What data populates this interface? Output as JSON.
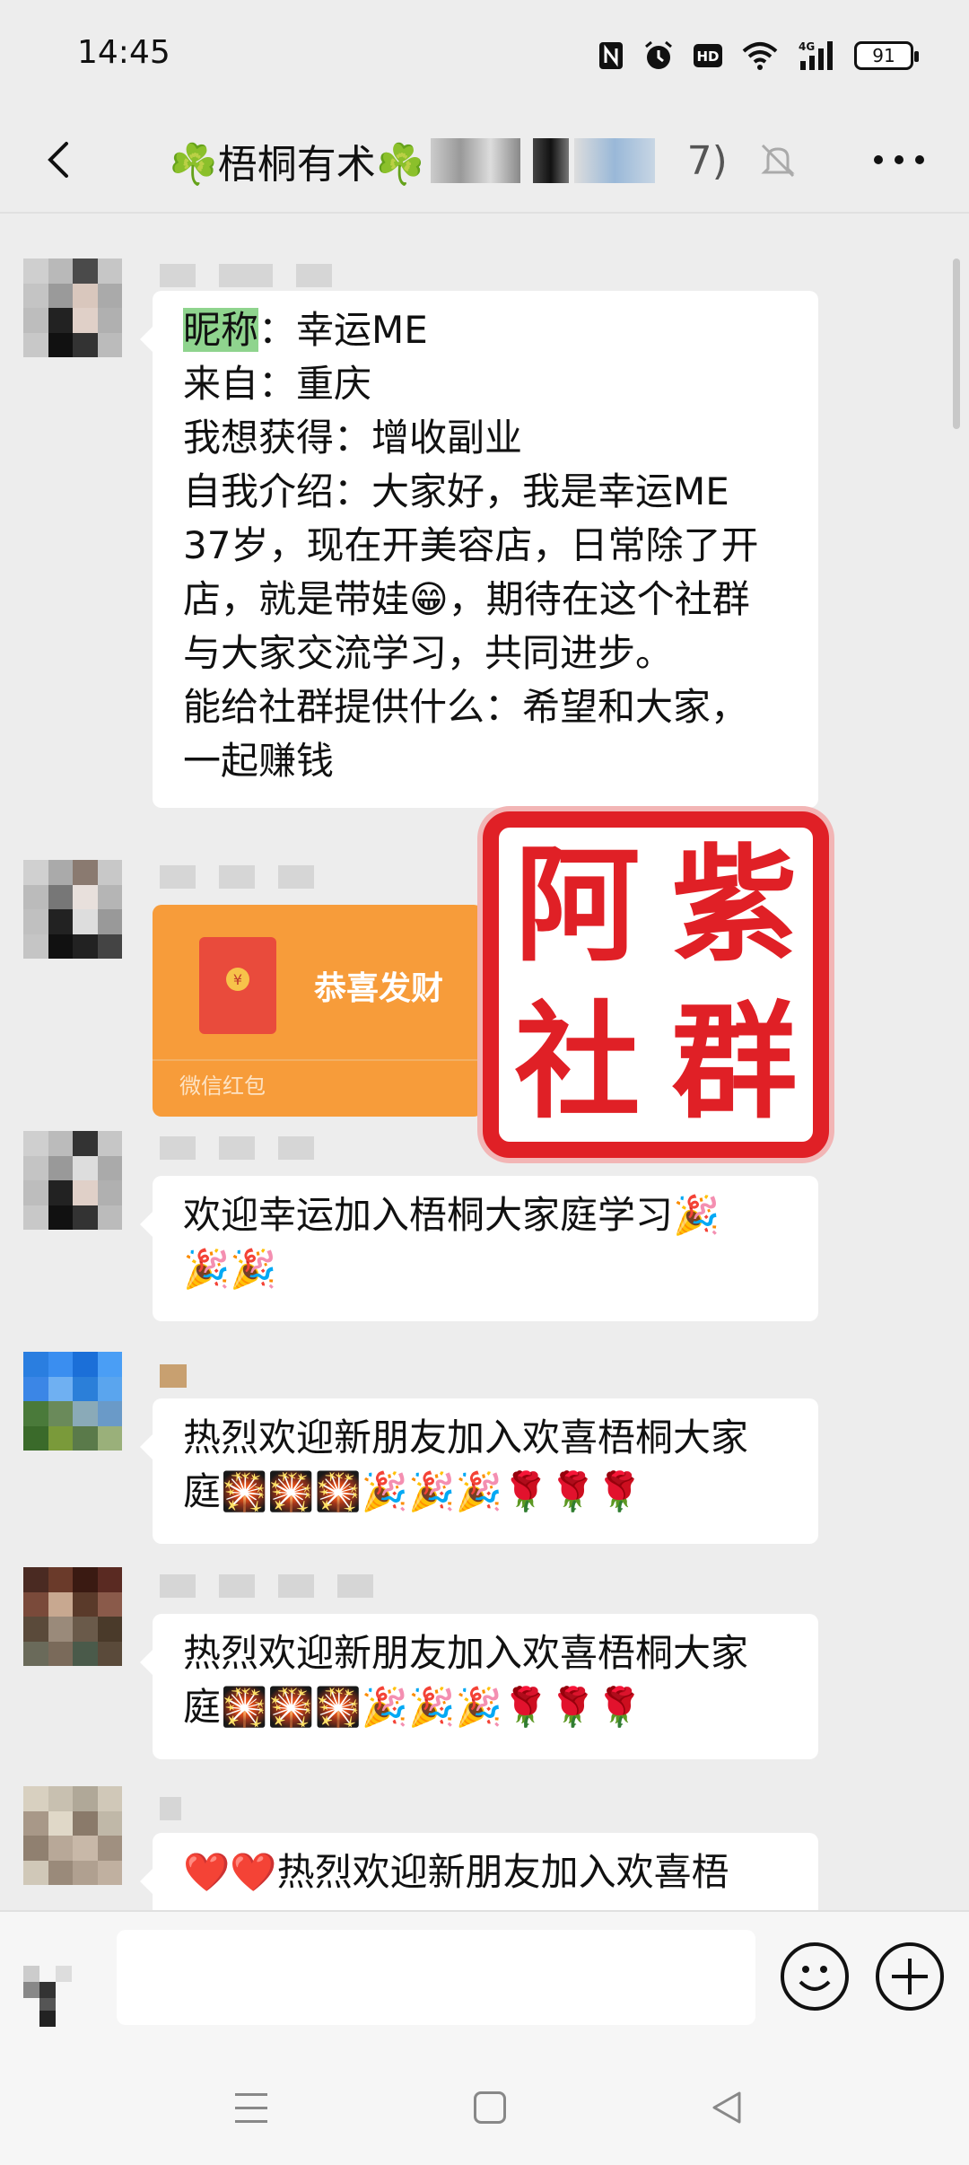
{
  "status_bar": {
    "time": "14:45",
    "battery": "91",
    "icons": [
      "nfc-icon",
      "alarm-icon",
      "hd-icon",
      "wifi-icon",
      "4g-signal-icon",
      "battery-icon"
    ]
  },
  "header": {
    "title": "☘️梧桐有术☘️",
    "title_suffix": "7)",
    "icons": [
      "back-arrow-icon",
      "mute-bell-icon",
      "more-icon"
    ]
  },
  "messages": [
    {
      "type": "text",
      "lines": [
        {
          "label": "昵称",
          "text": "：幸运ME"
        },
        {
          "text": "来自：重庆"
        },
        {
          "text": "我想获得：增收副业"
        },
        {
          "text": "自我介绍：大家好，我是幸运ME"
        },
        {
          "text": "37岁，现在开美容店，日常除了开"
        },
        {
          "text": "店，就是带娃😁，期待在这个社群"
        },
        {
          "text": "与大家交流学习，共同进步。"
        },
        {
          "text": "能给社群提供什么：希望和大家，"
        },
        {
          "text": "一起赚钱"
        }
      ]
    },
    {
      "type": "red_packet",
      "title": "恭喜发财",
      "footer": "微信红包"
    },
    {
      "type": "text",
      "lines": [
        {
          "text": "欢迎幸运加入梧桐大家庭学习🎉"
        },
        {
          "text": "🎉🎉"
        }
      ]
    },
    {
      "type": "text",
      "lines": [
        {
          "text": "热烈欢迎新朋友加入欢喜梧桐大家"
        },
        {
          "text": "庭🎇🎇🎇🎉🎉🎉🌹🌹🌹"
        }
      ]
    },
    {
      "type": "text",
      "lines": [
        {
          "text": "热烈欢迎新朋友加入欢喜梧桐大家"
        },
        {
          "text": "庭🎇🎇🎇🎉🎉🎉🌹🌹🌹"
        }
      ]
    },
    {
      "type": "text",
      "lines": [
        {
          "text": "❤️❤️热烈欢迎新朋友加入欢喜梧"
        }
      ]
    }
  ],
  "watermark": {
    "chars": [
      "阿",
      "紫",
      "社",
      "群"
    ]
  },
  "input_bar": {
    "placeholder": "",
    "icons": [
      "voice-icon",
      "emoji-icon",
      "plus-icon"
    ]
  },
  "system_nav": {
    "icons": [
      "menu-icon",
      "home-icon",
      "back-triangle-icon"
    ]
  },
  "colors": {
    "background": "#ededed",
    "bubble": "#ffffff",
    "red_packet": "#f79c3a",
    "stamp_red": "#e02026",
    "highlight": "#8fd48e"
  }
}
